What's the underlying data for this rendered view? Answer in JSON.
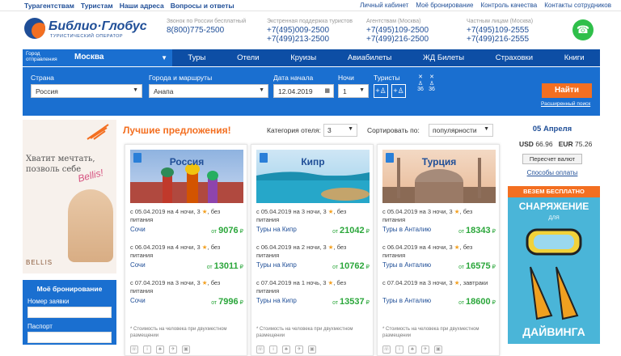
{
  "top_links_left": [
    "Турагентствам",
    "Туристам",
    "Наши адреса",
    "Вопросы и ответы"
  ],
  "top_links_right": [
    "Личный кабинет",
    "Моё бронирование",
    "Контроль качества",
    "Контакты сотрудников"
  ],
  "logo": {
    "name": "Библио·Глобус",
    "sub": "ТУРИСТИЧЕСКИЙ ОПЕРАТОР"
  },
  "phones": [
    {
      "label": "Звонок по России бесплатный",
      "nums": [
        "8(800)775-2500"
      ]
    },
    {
      "label": "Экстренная поддержка туристов",
      "nums": [
        "+7(495)009-2500",
        "+7(499)213-2500"
      ]
    },
    {
      "label": "Агентствам (Москва)",
      "nums": [
        "+7(495)109-2500",
        "+7(499)216-2500"
      ]
    },
    {
      "label": "Частным лицам (Москва)",
      "nums": [
        "+7(495)109-2555",
        "+7(499)216-2555"
      ]
    }
  ],
  "nav": {
    "city_label": "Город отправления",
    "city": "Москва",
    "items": [
      "Туры",
      "Отели",
      "Круизы",
      "Авиабилеты",
      "ЖД Билеты",
      "Страховки",
      "Книги"
    ]
  },
  "search": {
    "country_label": "Страна",
    "country": "Россия",
    "city_label": "Города и маршруты",
    "city": "Анапа",
    "date_label": "Дата начала",
    "date": "12.04.2019",
    "nights_label": "Ночи",
    "nights": "1",
    "tourists_label": "Туристы",
    "kid_age": "36",
    "find": "Найти",
    "advanced": "Расширенный поиск"
  },
  "promo": {
    "text": "Хватит мечтать, позволь себе",
    "brand_text": "Bellis!",
    "logo": "BELLIS"
  },
  "booking": {
    "title": "Моё бронирование",
    "order_label": "Номер заявки",
    "passport_label": "Паспорт"
  },
  "best": {
    "title": "Лучшие предложения!",
    "category_label": "Категория отеля:",
    "category": "3",
    "sort_label": "Сортировать по:",
    "sort": "популярности"
  },
  "cards": [
    {
      "country": "Россия",
      "offers": [
        {
          "text": "с 05.04.2019 на 4 ночи, 3",
          "meal": ", без питания",
          "dest": "Сочи",
          "price": "9076"
        },
        {
          "text": "с 06.04.2019 на 4 ночи, 3",
          "meal": ", без питания",
          "dest": "Сочи",
          "price": "13011"
        },
        {
          "text": "с 07.04.2019 на 3 ночи, 3",
          "meal": ", без питания",
          "dest": "Сочи",
          "price": "7996"
        }
      ]
    },
    {
      "country": "Кипр",
      "offers": [
        {
          "text": "с 05.04.2019 на 3 ночи, 3",
          "meal": ", без питания",
          "dest": "Туры на Кипр",
          "price": "21042"
        },
        {
          "text": "с 06.04.2019 на 2 ночи, 3",
          "meal": ", без питания",
          "dest": "Туры на Кипр",
          "price": "10762"
        },
        {
          "text": "с 07.04.2019 на 1 ночь, 3",
          "meal": ", без питания",
          "dest": "Туры на Кипр",
          "price": "13537"
        }
      ]
    },
    {
      "country": "Турция",
      "offers": [
        {
          "text": "с 05.04.2019 на 3 ночи, 3",
          "meal": ", без питания",
          "dest": "Туры в Анталию",
          "price": "18343"
        },
        {
          "text": "с 06.04.2019 на 4 ночи, 3",
          "meal": ", без питания",
          "dest": "Туры в Анталию",
          "price": "16575"
        },
        {
          "text": "с 07.04.2019 на 3 ночи, 3",
          "meal": ", завтраки",
          "dest": "Туры в Анталию",
          "price": "18600"
        }
      ]
    }
  ],
  "price_prefix": "от",
  "currency": "₽",
  "card_note": "* Стоимость на человека при двухместном размещении",
  "right": {
    "date": "05 Апреля",
    "usd_label": "USD",
    "usd": "66.96",
    "eur_label": "EUR",
    "eur": "75.26",
    "recalc": "Пересчет валют",
    "payment": "Способы оплаты"
  },
  "ad": {
    "t1": "ВЕЗЕМ БЕСПЛАТНО",
    "t2": "СНАРЯЖЕНИЕ",
    "t3": "ДЛЯ",
    "t4": "ДАЙВИНГА"
  }
}
